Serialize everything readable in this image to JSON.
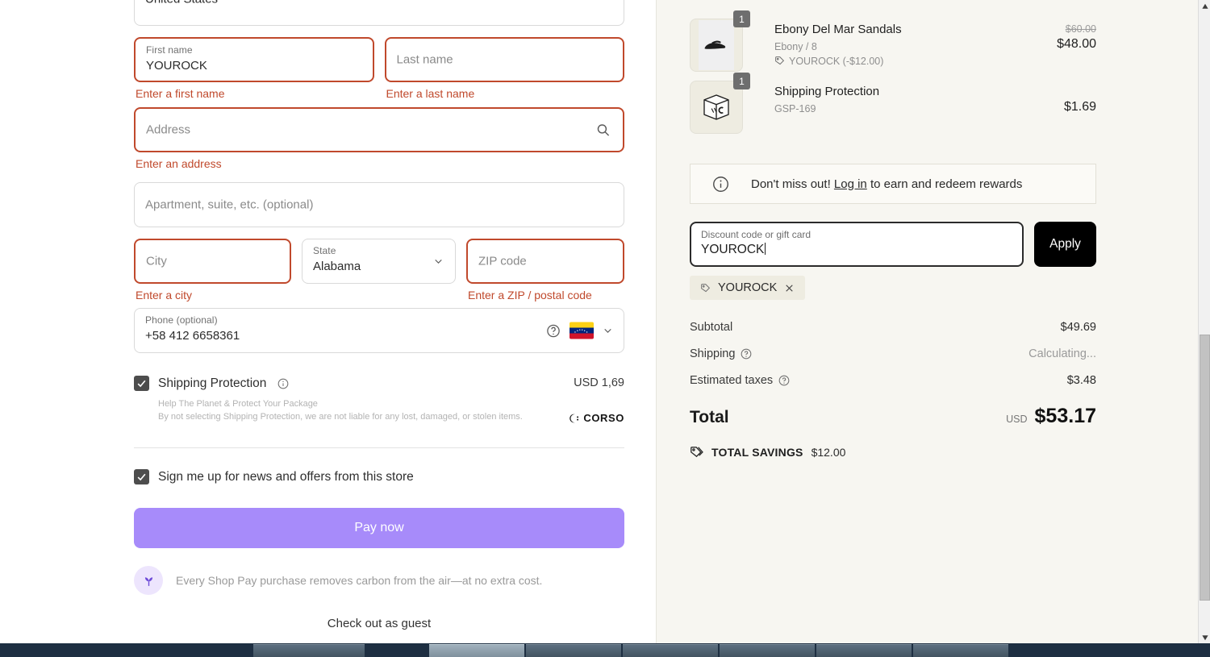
{
  "form": {
    "country_value": "United States",
    "first_name": {
      "label": "First name",
      "value": "YOUROCK",
      "error": "Enter a first name"
    },
    "last_name": {
      "placeholder": "Last name",
      "error": "Enter a last name"
    },
    "address": {
      "placeholder": "Address",
      "error": "Enter an address"
    },
    "apartment": {
      "placeholder": "Apartment, suite, etc. (optional)"
    },
    "city": {
      "placeholder": "City",
      "error": "Enter a city"
    },
    "state": {
      "label": "State",
      "value": "Alabama"
    },
    "zip": {
      "placeholder": "ZIP code",
      "error": "Enter a ZIP / postal code"
    },
    "phone": {
      "label": "Phone (optional)",
      "value": "+58 412 6658361"
    },
    "shipping_protection": {
      "title": "Shipping Protection",
      "price": "USD 1,69",
      "sub1": "Help The Planet & Protect Your Package",
      "sub2": "By not selecting Shipping Protection, we are not liable for any lost, damaged, or stolen items.",
      "brand": "CORSO"
    },
    "newsletter_label": "Sign me up for news and offers from this store",
    "pay_button": "Pay now",
    "carbon_note": "Every Shop Pay purchase removes carbon from the air—at no extra cost.",
    "guest_link": "Check out as guest"
  },
  "summary": {
    "items": [
      {
        "qty": "1",
        "title": "Ebony Del Mar Sandals",
        "variant": "Ebony / 8",
        "discount": "YOUROCK (-$12.00)",
        "price_original": "$60.00",
        "price": "$48.00"
      },
      {
        "qty": "1",
        "title": "Shipping Protection",
        "variant": "GSP-169",
        "price": "$1.69"
      }
    ],
    "rewards": {
      "prefix": "Don't miss out!",
      "link": "Log in",
      "suffix": "to earn and redeem rewards"
    },
    "discount": {
      "label": "Discount code or gift card",
      "value": "YOUROCK",
      "apply": "Apply",
      "chip": "YOUROCK"
    },
    "totals": [
      {
        "label": "Subtotal",
        "value": "$49.69",
        "help": false,
        "muted": false
      },
      {
        "label": "Shipping",
        "value": "Calculating...",
        "help": true,
        "muted": true
      },
      {
        "label": "Estimated taxes",
        "value": "$3.48",
        "help": true,
        "muted": false
      }
    ],
    "total": {
      "label": "Total",
      "currency": "USD",
      "amount": "$53.17"
    },
    "savings": {
      "label": "TOTAL SAVINGS",
      "amount": "$12.00"
    }
  },
  "colors": {
    "error": "#c0492c",
    "pay_button": "#a78bfa",
    "panel_right": "#f7f6f1"
  }
}
